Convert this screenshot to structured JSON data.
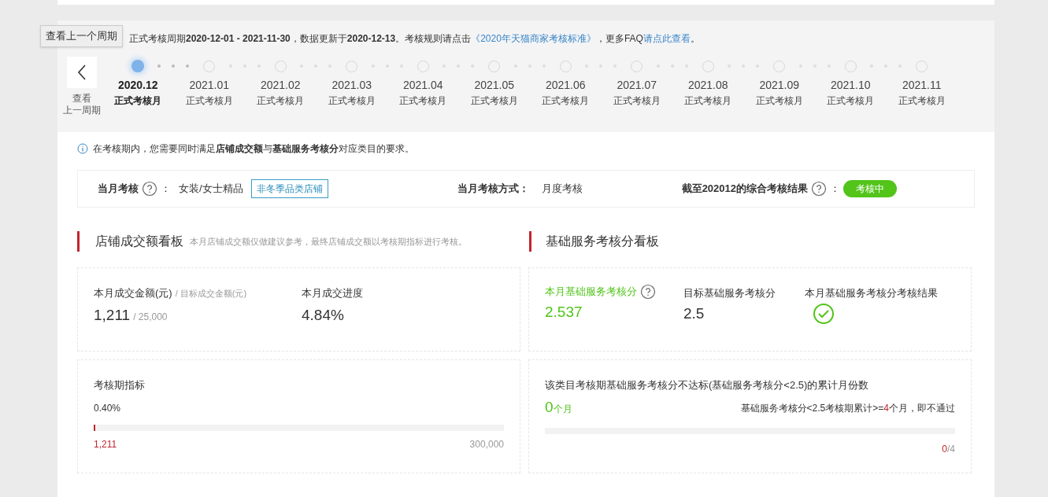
{
  "tooltip": "查看上一个周期",
  "header": {
    "notice_parts": [
      {
        "kind": "text",
        "text": "正式考核周期**2020-12-01 - 2021-11-30**，数据更新于**2020-12-13**。考核规则请点击"
      },
      {
        "kind": "link",
        "text": "《2020年天猫商家考核标准》"
      },
      {
        "kind": "text",
        "text": "，更多FAQ"
      },
      {
        "kind": "link",
        "text": "请点此查看"
      },
      {
        "kind": "text",
        "text": "。"
      }
    ],
    "prev_button": {
      "label_lines": [
        "查看",
        "上一周期"
      ]
    },
    "months": [
      {
        "month": "2020.12",
        "label": "正式考核月",
        "selected": true
      },
      {
        "month": "2021.01",
        "label": "正式考核月",
        "selected": false
      },
      {
        "month": "2021.02",
        "label": "正式考核月",
        "selected": false
      },
      {
        "month": "2021.03",
        "label": "正式考核月",
        "selected": false
      },
      {
        "month": "2021.04",
        "label": "正式考核月",
        "selected": false
      },
      {
        "month": "2021.05",
        "label": "正式考核月",
        "selected": false
      },
      {
        "month": "2021.06",
        "label": "正式考核月",
        "selected": false
      },
      {
        "month": "2021.07",
        "label": "正式考核月",
        "selected": false
      },
      {
        "month": "2021.08",
        "label": "正式考核月",
        "selected": false
      },
      {
        "month": "2021.09",
        "label": "正式考核月",
        "selected": false
      },
      {
        "month": "2021.10",
        "label": "正式考核月",
        "selected": false
      },
      {
        "month": "2021.11",
        "label": "正式考核月",
        "selected": false
      }
    ]
  },
  "hint": "在考核期内，您需要同时满足**店铺成交额**与**基础服务考核分**对应类目的要求。",
  "summary": {
    "assess_label": "当月考核",
    "colon": "：",
    "category": "女装/女士精品",
    "tag": "非冬季品类店铺",
    "method_label": "当月考核方式：",
    "method": "月度考核",
    "result_label": "截至202012的综合考核结果",
    "result_colon": "：",
    "result": "考核中"
  },
  "sales": {
    "title": "店铺成交额看板",
    "note": "本月店铺成交额仅做建议参考，最终店铺成交额以考核期指标进行考核。",
    "amount_label": "本月成交金额(元)",
    "target_label": "/ 目标成交金额(元)",
    "amount": "1,211",
    "target": "/ 25,000",
    "progress_label": "本月成交进度",
    "progress": "4.84%",
    "period_label": "考核期指标",
    "period_pct": "0.40%",
    "level": 0.004,
    "current": "1,211",
    "max": "300,000"
  },
  "service": {
    "title": "基础服务考核分看板",
    "score_label": "本月基础服务考核分",
    "score": "2.537",
    "target_label": "目标基础服务考核分",
    "target": "2.5",
    "result_label": "本月基础服务考核分考核结果",
    "passed": true,
    "fail_title": "该类目考核期基础服务考核分不达标(基础服务考核分<2.5)的累计月份数",
    "months": "0",
    "months_unit": "个月",
    "rule_parts": [
      "基础服务考核分<2.5考核期累计>=",
      "4",
      "个月，即不通过"
    ],
    "level": 0,
    "count": "0",
    "total": "/4"
  }
}
